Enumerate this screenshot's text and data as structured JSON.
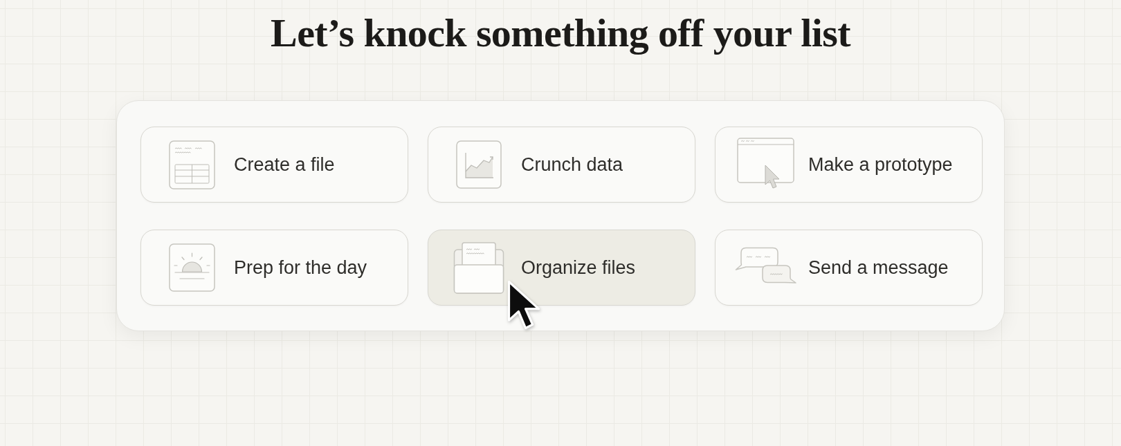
{
  "heading": "Let’s knock something off your list",
  "actions": [
    {
      "label": "Create a file",
      "hovered": false
    },
    {
      "label": "Crunch data",
      "hovered": false
    },
    {
      "label": "Make a prototype",
      "hovered": false
    },
    {
      "label": "Prep for the day",
      "hovered": false
    },
    {
      "label": "Organize files",
      "hovered": true
    },
    {
      "label": "Send a message",
      "hovered": false
    }
  ]
}
